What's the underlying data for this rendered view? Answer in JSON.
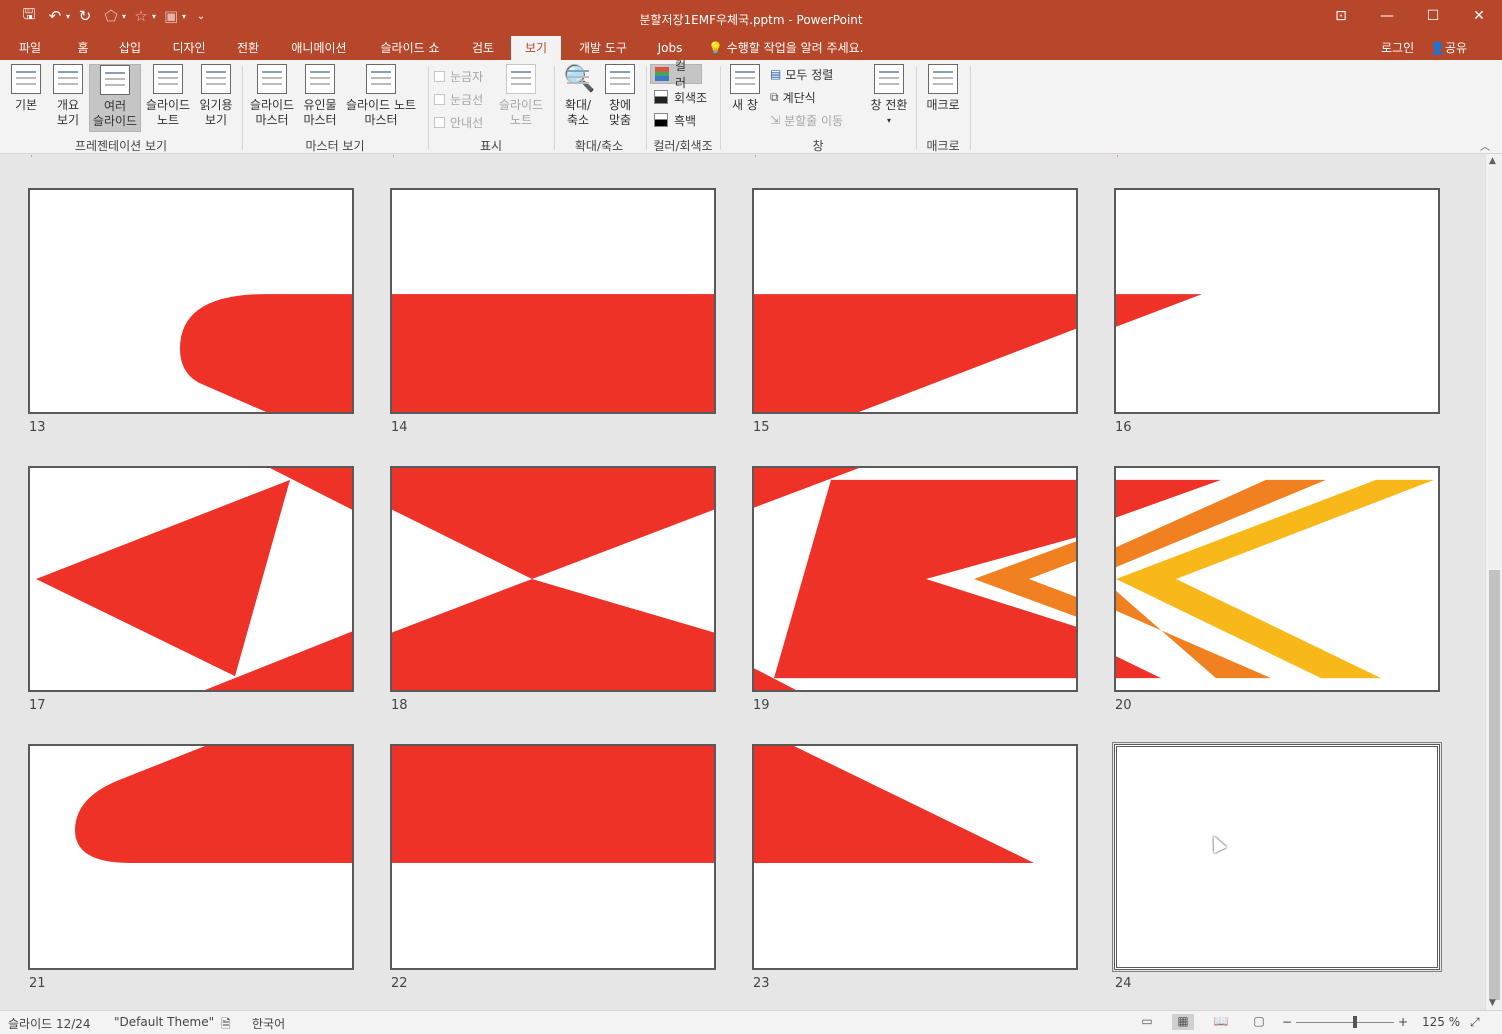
{
  "window": {
    "title": "분할저장1EMF우체국.pptm - PowerPoint",
    "controls": {
      "restore_ribbon": "⊡",
      "minimize": "—",
      "maximize": "☐",
      "close": "✕"
    }
  },
  "qat": {
    "save": "🖫",
    "undo": "↶",
    "redo": "↻",
    "more": "⌄"
  },
  "tabs": [
    {
      "label": "파일"
    },
    {
      "label": "홈"
    },
    {
      "label": "삽입"
    },
    {
      "label": "디자인"
    },
    {
      "label": "전환"
    },
    {
      "label": "애니메이션"
    },
    {
      "label": "슬라이드 쇼"
    },
    {
      "label": "검토"
    },
    {
      "label": "보기"
    },
    {
      "label": "개발 도구"
    },
    {
      "label": "Jobs"
    }
  ],
  "tell_me": "수행할 작업을 알려 주세요.",
  "account": {
    "login": "로그인",
    "share": "공유"
  },
  "ribbon": {
    "pres_views": {
      "label": "프레젠테이션 보기",
      "normal": [
        "기본"
      ],
      "outline": [
        "개요",
        "보기"
      ],
      "sorter": [
        "여러",
        "슬라이드"
      ],
      "notes": [
        "슬라이드",
        "노트"
      ],
      "reading": [
        "읽기용",
        "보기"
      ]
    },
    "master_views": {
      "label": "마스터 보기",
      "slide_master": [
        "슬라이드",
        "마스터"
      ],
      "handout_master": [
        "유인물",
        "마스터"
      ],
      "notes_master": [
        "슬라이드 노트",
        "마스터"
      ]
    },
    "show": {
      "label": "표시",
      "ruler": "눈금자",
      "gridlines": "눈금선",
      "guides": "안내선",
      "notes": [
        "슬라이드",
        "노트"
      ]
    },
    "zoom": {
      "label": "확대/축소",
      "zoom": [
        "확대/",
        "축소"
      ],
      "fit": [
        "창에",
        "맞춤"
      ]
    },
    "color": {
      "label": "컬러/회색조",
      "color": "컬러",
      "grayscale": "회색조",
      "bw": "흑백"
    },
    "window": {
      "label": "창",
      "new_window": [
        "새 창"
      ],
      "arrange_all": "모두 정렬",
      "cascade": "계단식",
      "move_split": "분할줄 이동",
      "switch": [
        "창 전환"
      ]
    },
    "macros": {
      "label": "매크로",
      "macros": [
        "매크로"
      ]
    }
  },
  "slides": [
    {
      "number": "13",
      "design": "rounded-right"
    },
    {
      "number": "14",
      "design": "band-middle"
    },
    {
      "number": "15",
      "design": "band-diagonal"
    },
    {
      "number": "16",
      "design": "small-wedge"
    },
    {
      "number": "17",
      "design": "triangle-left"
    },
    {
      "number": "18",
      "design": "hourglass"
    },
    {
      "number": "19",
      "design": "chevrons-red"
    },
    {
      "number": "20",
      "design": "chevrons-color"
    },
    {
      "number": "21",
      "design": "rounded-left-top"
    },
    {
      "number": "22",
      "design": "band-top"
    },
    {
      "number": "23",
      "design": "wedge-top"
    },
    {
      "number": "24",
      "design": "blank",
      "selected": true
    }
  ],
  "colors": {
    "red": "#ee3228",
    "orange": "#f08020",
    "yellow": "#f9b81a",
    "accent": "#b7472a"
  },
  "status": {
    "slide_of": "슬라이드 12/24",
    "theme": "\"Default Theme\"",
    "language": "한국어",
    "zoom_level": "125 %"
  }
}
